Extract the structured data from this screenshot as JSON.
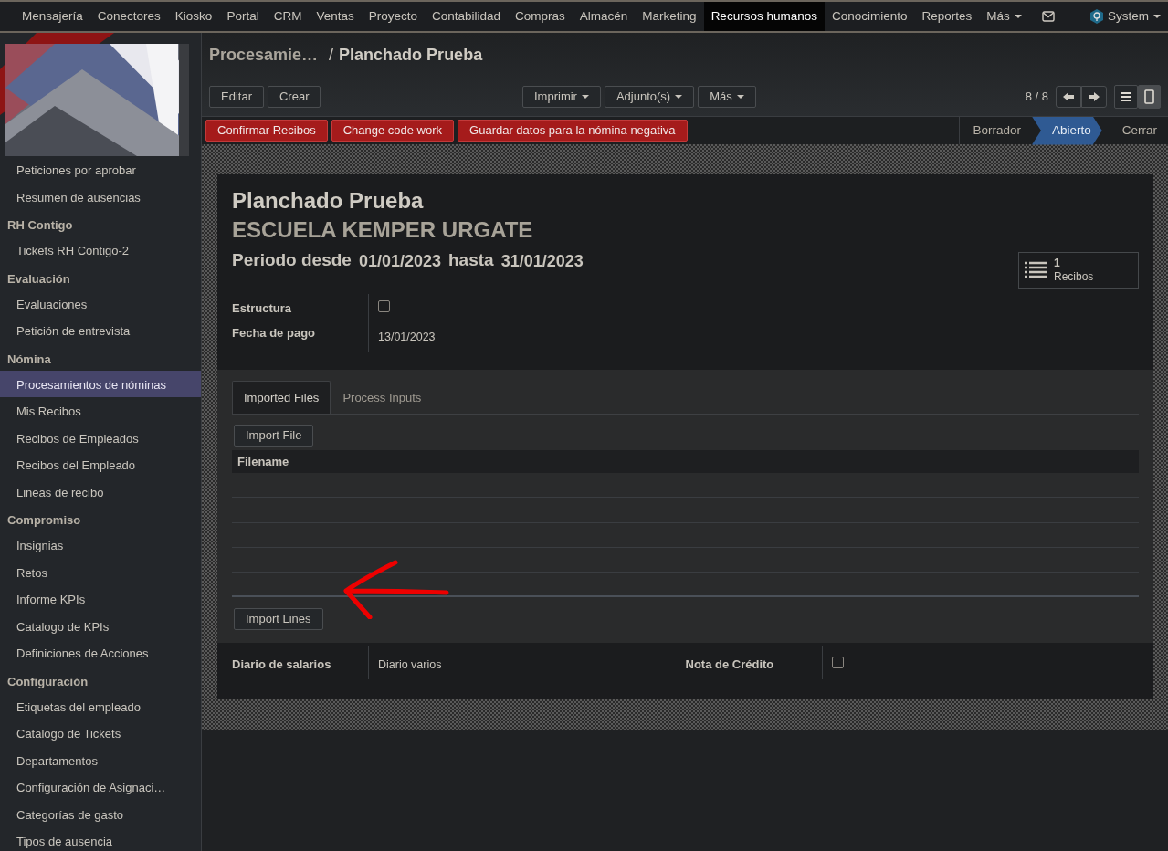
{
  "top_menu": [
    {
      "label": "Mensajería",
      "selected": false
    },
    {
      "label": "Conectores",
      "selected": false
    },
    {
      "label": "Kiosko",
      "selected": false
    },
    {
      "label": "Portal",
      "selected": false
    },
    {
      "label": "CRM",
      "selected": false
    },
    {
      "label": "Ventas",
      "selected": false
    },
    {
      "label": "Proyecto",
      "selected": false
    },
    {
      "label": "Contabilidad",
      "selected": false
    },
    {
      "label": "Compras",
      "selected": false
    },
    {
      "label": "Almacén",
      "selected": false
    },
    {
      "label": "Marketing",
      "selected": false
    },
    {
      "label": "Recursos humanos",
      "selected": true
    },
    {
      "label": "Conocimiento",
      "selected": false
    },
    {
      "label": "Reportes",
      "selected": false
    }
  ],
  "top_more": "Más",
  "user": "System",
  "sidebar": [
    {
      "kind": "item",
      "label": "Peticiones por aprobar",
      "selected": false
    },
    {
      "kind": "item",
      "label": "Resumen de ausencias",
      "selected": false
    },
    {
      "kind": "header",
      "label": "RH Contigo"
    },
    {
      "kind": "item",
      "label": "Tickets RH Contigo-2",
      "selected": false
    },
    {
      "kind": "header",
      "label": "Evaluación"
    },
    {
      "kind": "item",
      "label": "Evaluaciones",
      "selected": false
    },
    {
      "kind": "item",
      "label": "Petición de entrevista",
      "selected": false
    },
    {
      "kind": "header",
      "label": "Nómina"
    },
    {
      "kind": "item",
      "label": "Procesamientos de nóminas",
      "selected": true
    },
    {
      "kind": "item",
      "label": "Mis Recibos",
      "selected": false
    },
    {
      "kind": "item",
      "label": "Recibos de Empleados",
      "selected": false
    },
    {
      "kind": "item",
      "label": "Recibos del Empleado",
      "selected": false
    },
    {
      "kind": "item",
      "label": "Lineas de recibo",
      "selected": false
    },
    {
      "kind": "header",
      "label": "Compromiso"
    },
    {
      "kind": "item",
      "label": "Insignias",
      "selected": false
    },
    {
      "kind": "item",
      "label": "Retos",
      "selected": false
    },
    {
      "kind": "item",
      "label": "Informe KPIs",
      "selected": false
    },
    {
      "kind": "item",
      "label": "Catalogo de KPIs",
      "selected": false
    },
    {
      "kind": "item",
      "label": "Definiciones de Acciones",
      "selected": false
    },
    {
      "kind": "header",
      "label": "Configuración"
    },
    {
      "kind": "item",
      "label": "Etiquetas del empleado",
      "selected": false
    },
    {
      "kind": "item",
      "label": "Catalogo de Tickets",
      "selected": false
    },
    {
      "kind": "item",
      "label": "Departamentos",
      "selected": false
    },
    {
      "kind": "item",
      "label": "Configuración de Asignaci…",
      "selected": false
    },
    {
      "kind": "item",
      "label": "Categorías de gasto",
      "selected": false
    },
    {
      "kind": "item",
      "label": "Tipos de ausencia",
      "selected": false
    }
  ],
  "breadcrumb": [
    "Procesamie…",
    "Planchado Prueba"
  ],
  "breadcrumb_separator": "/",
  "buttons": [
    "Editar",
    "Crear"
  ],
  "dropdowns": [
    "Imprimir",
    "Adjunto(s)",
    "Más"
  ],
  "pager": "8 / 8",
  "views": [
    {
      "kind": "list",
      "selected": false
    },
    {
      "kind": "form",
      "selected": true
    }
  ],
  "action_buttons": [
    "Confirmar Recibos",
    "Change code work",
    "Guardar datos para la nómina negativa"
  ],
  "status_steps": [
    {
      "label": "Borrador",
      "selected": false
    },
    {
      "label": "Abierto",
      "selected": true
    },
    {
      "label": "Cerrar",
      "selected": false
    }
  ],
  "form": {
    "title": "Planchado Prueba",
    "subtitle": "ESCUELA KEMPER URGATE",
    "period": {
      "from_label": "Periodo desde",
      "from": "01/01/2023",
      "to_label": "hasta",
      "to": "31/01/2023"
    },
    "smart_button": {
      "count": "1",
      "label": "Recibos"
    },
    "fields": [
      {
        "label": "Estructura",
        "kind": "checkbox",
        "checked": false
      },
      {
        "label": "Fecha de pago",
        "kind": "text",
        "value": "13/01/2023"
      }
    ],
    "tabs": [
      {
        "label": "Imported Files",
        "selected": true
      },
      {
        "label": "Process Inputs",
        "selected": false
      }
    ],
    "import_file_button": "Import File",
    "table_columns": [
      "Filename"
    ],
    "import_lines_button": "Import Lines",
    "bottom_fields": [
      {
        "label": "Diario de salarios",
        "kind": "text",
        "value": "Diario varios"
      },
      {
        "label": "Nota de Crédito",
        "kind": "checkbox",
        "checked": false
      }
    ]
  }
}
